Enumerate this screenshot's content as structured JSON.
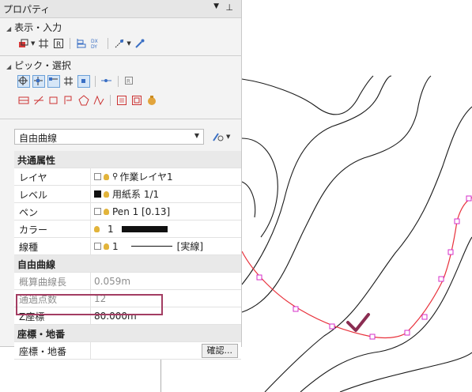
{
  "panel": {
    "title": "プロパティ",
    "dropdown_icon": "dropdown-arrow-icon",
    "pin_icon": "pin-icon"
  },
  "sections": {
    "display_input": "表示・入力",
    "pick_select": "ピック・選択"
  },
  "element_type": {
    "selected": "自由曲線"
  },
  "properties": {
    "common_header": "共通属性",
    "layer_label": "レイヤ",
    "layer_value": "作業レイヤ1",
    "level_label": "レベル",
    "level_value": "用紙系 1/1",
    "pen_label": "ペン",
    "pen_value": "Pen 1 [0.13]",
    "color_label": "カラー",
    "color_value": "1",
    "linetype_label": "線種",
    "linetype_value": "1",
    "linetype_name": "[実線]",
    "curve_header": "自由曲線",
    "approx_length_label": "概算曲線長",
    "approx_length_value": "0.059m",
    "points_label": "通過点数",
    "points_value": "12",
    "z_label": "Z座標",
    "z_value": "80.000m",
    "coord_header": "座標・地番",
    "coord_label": "座標・地番",
    "confirm_button": "確認..."
  },
  "colors": {
    "selected_curve": "#e8323c",
    "vertex_marker": "#d52ec9",
    "highlight_box": "#a33d62",
    "check_mark": "#8b2d52"
  }
}
